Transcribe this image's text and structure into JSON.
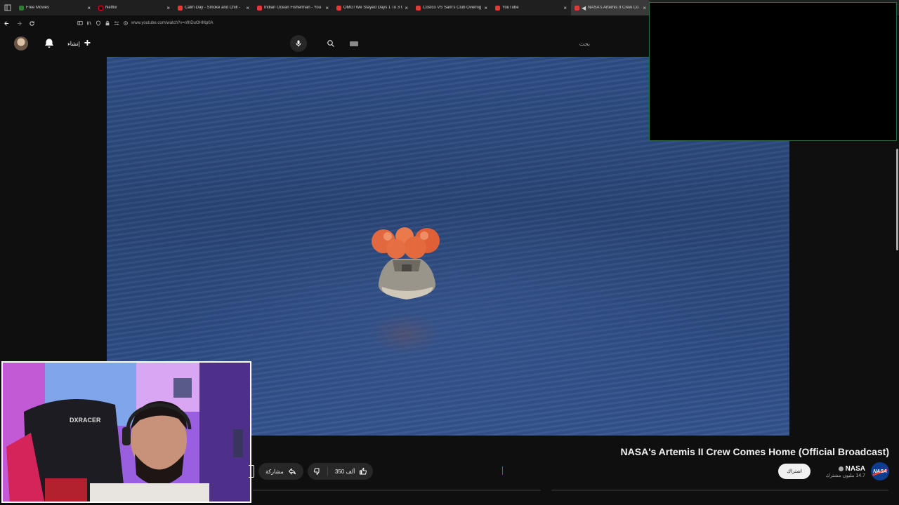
{
  "browser": {
    "tabs": [
      {
        "title": "Free Movies",
        "favicon_color": "#2e7d32"
      },
      {
        "title": "Netflix",
        "favicon_color": "#111111"
      },
      {
        "title": "Calm Day - Smoke and Chill -",
        "favicon_color": "#e53935"
      },
      {
        "title": "Indian Ocean Fisherman - You",
        "favicon_color": "#e53935"
      },
      {
        "title": "OMG! We Stayed Days 1 To 3 G",
        "favicon_color": "#e53935"
      },
      {
        "title": "Costco VS Sam's Club Overnig",
        "favicon_color": "#e53935"
      },
      {
        "title": "YouTube",
        "favicon_color": "#e53935"
      },
      {
        "title": "NASA's Artemis II Crew Co",
        "favicon_color": "#e53935",
        "active": true
      }
    ],
    "url": "www.youtube.com/watch?v=nfhDuOHMp0A"
  },
  "header": {
    "create_label": "إنشاء",
    "search_placeholder": "بحث"
  },
  "video": {
    "title": "NASA's Artemis II Crew Comes Home (Official Broadcast)"
  },
  "channel": {
    "name": "NASA",
    "subscribers": "14.7 مليون مشترك",
    "subscribe_label": "اشتراك",
    "logo_text": "NASA"
  },
  "actions": {
    "likes": "350 ألف",
    "share_label": "مشاركة"
  },
  "colors": {
    "accent": "#ff0000",
    "background": "#0f0f0f",
    "pill": "#272727"
  }
}
